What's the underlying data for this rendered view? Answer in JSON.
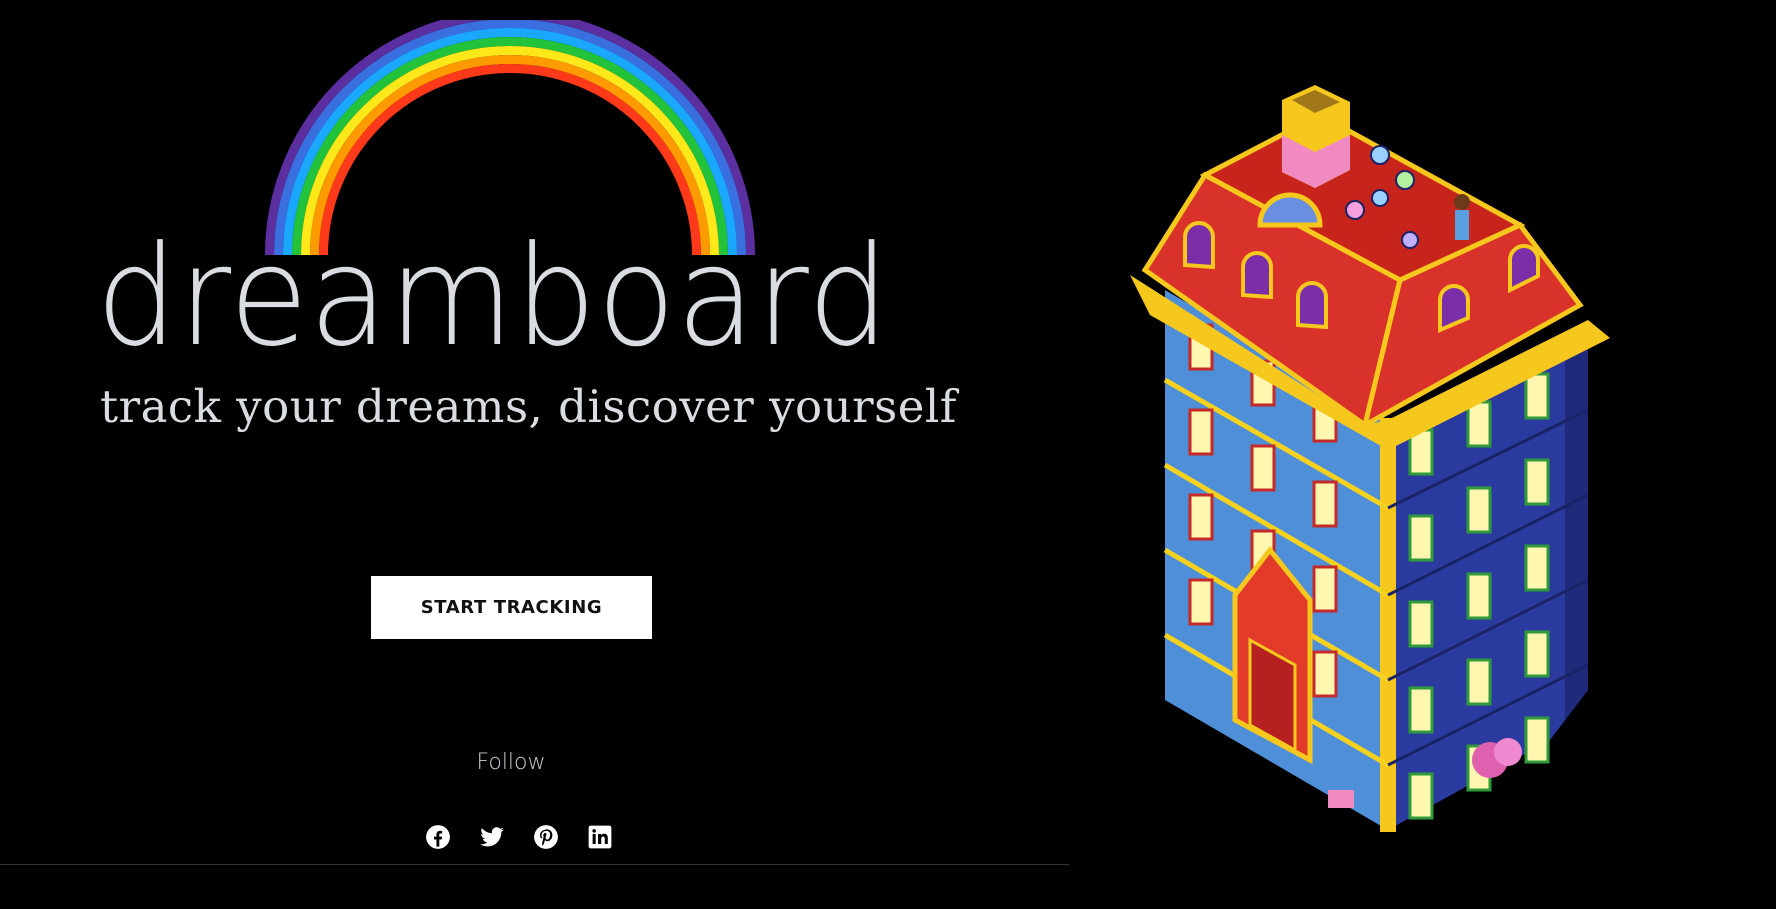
{
  "hero": {
    "logo_text": "dreamboard",
    "tagline": "track your dreams, discover yourself",
    "cta_label": "START TRACKING"
  },
  "social": {
    "label": "Follow",
    "links": [
      {
        "name": "facebook",
        "icon": "facebook-icon"
      },
      {
        "name": "twitter",
        "icon": "twitter-icon"
      },
      {
        "name": "pinterest",
        "icon": "pinterest-icon"
      },
      {
        "name": "linkedin",
        "icon": "linkedin-icon"
      }
    ]
  },
  "colors": {
    "background": "#000000",
    "text_light": "#d9dde1",
    "button_bg": "#ffffff",
    "button_text": "#111111",
    "rainbow": [
      "#5b2fa0",
      "#3a6fe0",
      "#1aa8ff",
      "#22c23a",
      "#ffe81a",
      "#ff9a00",
      "#ff3a1a"
    ]
  }
}
